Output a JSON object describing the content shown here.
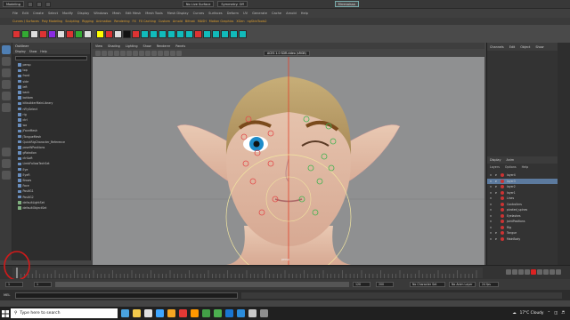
{
  "topbar": {
    "mode": "Modeling",
    "live_surface": "No Live Surface",
    "symmetry": "Symmetry: Off",
    "workspace": "Mrrenaissa"
  },
  "menubar": [
    "File",
    "Edit",
    "Create",
    "Select",
    "Modify",
    "Display",
    "Windows",
    "Mesh",
    "Edit Mesh",
    "Mesh Tools",
    "Mesh Display",
    "Curves",
    "Surfaces",
    "Deform",
    "UV",
    "Generate",
    "Cache",
    "Arnold",
    "Help"
  ],
  "shelf": {
    "tabs": [
      "Curves / Surfaces",
      "Poly Modeling",
      "Sculpting",
      "Rigging",
      "Animation",
      "Rendering",
      "FX",
      "FX Caching",
      "Custom",
      "Arnold",
      "Bifrost",
      "MASH",
      "Motion Graphics",
      "XGen",
      "ngSkinTools2"
    ],
    "colors": [
      "#d33",
      "#3a3",
      "#ddd",
      "#d33",
      "#8a2be2",
      "#ddd",
      "#d33",
      "#3a3",
      "#ddd",
      "#ff0",
      "#d33",
      "#ddd",
      "#111",
      "#d33",
      "#1bb",
      "#1bb",
      "#1bb",
      "#1bb",
      "#1bb",
      "#1bb",
      "#d33",
      "#1bb",
      "#1bb",
      "#1bb",
      "#1bb",
      "#1bb"
    ]
  },
  "outliner": {
    "title": "Outliner",
    "menu": [
      "Display",
      "Show",
      "Help"
    ],
    "items": [
      "persp",
      "top",
      "front",
      "side",
      "left",
      "back",
      "bottom",
      "kitbuilderMainLibrary",
      "nFlySelect",
      "rig",
      "ctrl",
      "wa",
      "jFaceMesh",
      "jTongueMesh",
      "QuickRigCharacter_Reference",
      "poseWPositions",
      "gRotation",
      "ctrlLoft",
      "LimbFollowTechSet",
      "Eye",
      "EyeR",
      "Brows",
      "Face",
      "PosItG1",
      "PosItG2",
      "defaultLightSet",
      "defaultObjectSet"
    ]
  },
  "viewport": {
    "menu": [
      "View",
      "Shading",
      "Lighting",
      "Show",
      "Renderer",
      "Panels"
    ],
    "label": "ACES 1.0 SDR-video (sRGB)",
    "camera": "persp"
  },
  "channels": {
    "tabs": [
      "Channels",
      "Edit",
      "Object",
      "Show"
    ],
    "layer_tabs": [
      "Display",
      "Anim"
    ],
    "layer_menu": [
      "Layers",
      "Options",
      "Help"
    ],
    "layers": [
      {
        "v": "V",
        "p": "P",
        "name": "layer4",
        "sel": false
      },
      {
        "v": "V",
        "p": "P",
        "name": "layer3",
        "sel": true
      },
      {
        "v": "V",
        "p": "P",
        "name": "layer2",
        "sel": false
      },
      {
        "v": "V",
        "p": "P",
        "name": "layer1",
        "sel": false
      },
      {
        "v": "V",
        "p": "",
        "name": "Lines",
        "sel": false
      },
      {
        "v": "V",
        "p": "",
        "name": "Controllers",
        "sel": false
      },
      {
        "v": "V",
        "p": "",
        "name": "pivoted_spines",
        "sel": false
      },
      {
        "v": "V",
        "p": "",
        "name": "Eyelashes",
        "sel": false
      },
      {
        "v": "V",
        "p": "",
        "name": "JointPositions",
        "sel": false
      },
      {
        "v": "V",
        "p": "",
        "name": "Rig",
        "sel": false
      },
      {
        "v": "V",
        "p": "P",
        "name": "Tongue",
        "sel": false
      },
      {
        "v": "V",
        "p": "P",
        "name": "MainBody",
        "sel": false
      }
    ]
  },
  "range": {
    "start": "1",
    "inner_start": "1",
    "inner_end": "120",
    "end": "200",
    "character_set": "No Character Set",
    "anim_layer": "No Anim Layer",
    "fps": "24 fps"
  },
  "cmd": {
    "label": "MEL"
  },
  "taskbar": {
    "search_placeholder": "Type here to search",
    "apps": [
      "#4aa3df",
      "#f2c94c",
      "#e0e0e0",
      "#3ea6ff",
      "#f5a623",
      "#e53935",
      "#ff9800",
      "#43a047",
      "#4caf50",
      "#1976d2",
      "#2b8cdb",
      "#c8c8c8",
      "#8e8e8e"
    ],
    "weather": "17°C  Cloudy"
  }
}
